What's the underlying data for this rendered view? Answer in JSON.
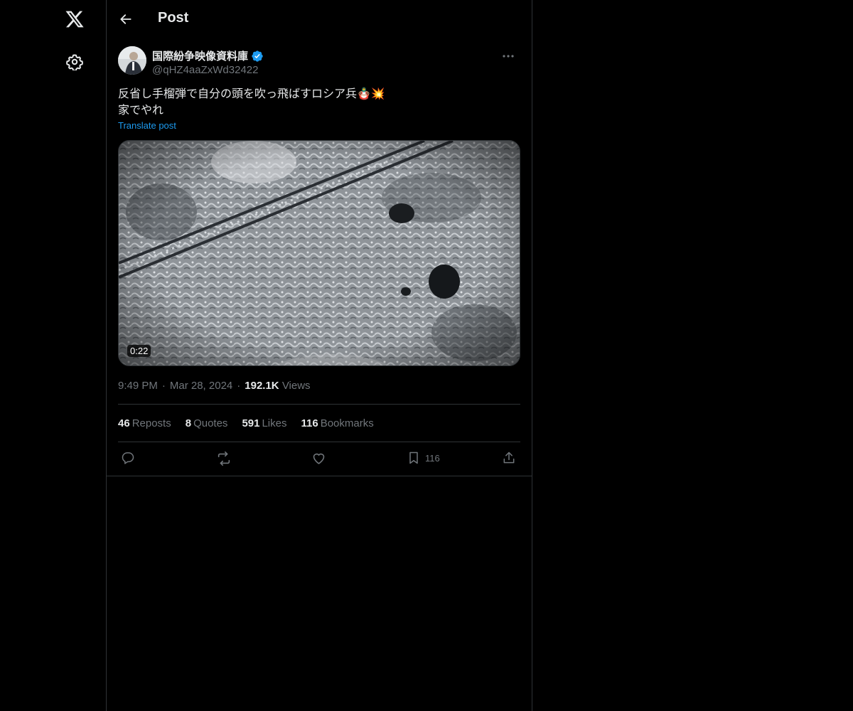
{
  "header": {
    "title": "Post"
  },
  "post": {
    "author": {
      "display_name": "国際紛争映像資料庫",
      "handle": "@qHZ4aaZxWd32422",
      "verified": true
    },
    "text_lines": [
      "反省し手榴弾で自分の頭を吹っ飛ばすロシア兵🪆💥",
      "家でやれ"
    ],
    "translate_label": "Translate post",
    "video": {
      "duration": "0:22"
    },
    "meta": {
      "time": "9:49 PM",
      "date": "Mar 28, 2024",
      "views_count": "192.1K",
      "views_label": "Views",
      "separator": "·"
    },
    "stats": [
      {
        "count": "46",
        "label": "Reposts"
      },
      {
        "count": "8",
        "label": "Quotes"
      },
      {
        "count": "591",
        "label": "Likes"
      },
      {
        "count": "116",
        "label": "Bookmarks"
      }
    ],
    "actions": {
      "bookmark_count": "116"
    }
  },
  "colors": {
    "background": "#000000",
    "text_primary": "#e7e9ea",
    "text_secondary": "#71767b",
    "accent": "#1d9bf0",
    "border": "#2f3336"
  }
}
